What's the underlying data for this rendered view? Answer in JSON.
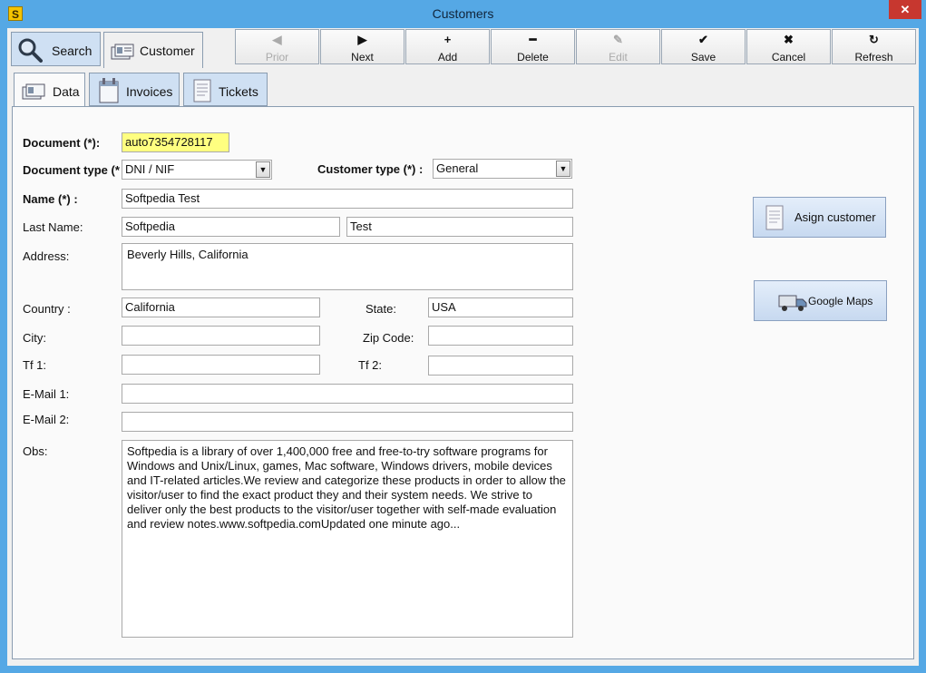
{
  "window": {
    "title": "Customers",
    "icon_letter": "S",
    "close_glyph": "✕"
  },
  "top_tabs": [
    {
      "label": "Search",
      "icon": "magnifier-icon"
    },
    {
      "label": "Customer",
      "icon": "id-cards-icon"
    }
  ],
  "toolbar": {
    "buttons": [
      {
        "label": "Prior",
        "glyph": "◀",
        "enabled": false
      },
      {
        "label": "Next",
        "glyph": "▶",
        "enabled": true
      },
      {
        "label": "Add",
        "glyph": "+",
        "enabled": true
      },
      {
        "label": "Delete",
        "glyph": "━",
        "enabled": true
      },
      {
        "label": "Edit",
        "glyph": "✎",
        "enabled": false
      },
      {
        "label": "Save",
        "glyph": "✔",
        "enabled": true
      },
      {
        "label": "Cancel",
        "glyph": "✖",
        "enabled": true
      },
      {
        "label": "Refresh",
        "glyph": "↻",
        "enabled": true
      }
    ]
  },
  "sub_tabs": [
    {
      "label": "Data",
      "icon": "id-card-icon"
    },
    {
      "label": "Invoices",
      "icon": "invoice-icon"
    },
    {
      "label": "Tickets",
      "icon": "ticket-icon"
    }
  ],
  "form": {
    "document": {
      "label": "Document (*):",
      "value": "auto7354728117"
    },
    "document_type": {
      "label": "Document type (*",
      "value": "DNI / NIF"
    },
    "customer_type": {
      "label": "Customer type (*) :",
      "value": "General"
    },
    "name": {
      "label": "Name (*) :",
      "value": "Softpedia Test"
    },
    "last_name": {
      "label": "Last Name:",
      "value1": "Softpedia",
      "value2": "Test"
    },
    "address": {
      "label": "Address:",
      "value": "Beverly Hills, California"
    },
    "country": {
      "label": "Country :",
      "value": "California"
    },
    "state": {
      "label": "State:",
      "value": "USA"
    },
    "city": {
      "label": "City:",
      "value": ""
    },
    "zip": {
      "label": "Zip Code:",
      "value": ""
    },
    "tf1": {
      "label": "Tf 1:",
      "value": ""
    },
    "tf2": {
      "label": "Tf 2:",
      "value": ""
    },
    "email1": {
      "label": "E-Mail 1:",
      "value": ""
    },
    "email2": {
      "label": "E-Mail 2:",
      "value": ""
    },
    "obs": {
      "label": "Obs:",
      "value": "Softpedia is a library of over 1,400,000 free and free-to-try software programs for Windows and Unix/Linux, games, Mac software, Windows drivers, mobile devices and IT-related articles.We review and categorize these products in order to allow the visitor/user to find the exact product they and their system needs. We strive to deliver only the best products to the visitor/user together with self-made evaluation and review notes.www.softpedia.comUpdated one minute ago..."
    }
  },
  "side_buttons": {
    "assign": {
      "label": "Asign customer",
      "icon": "document-icon"
    },
    "maps": {
      "label": "Google Maps",
      "icon": "truck-icon"
    }
  }
}
